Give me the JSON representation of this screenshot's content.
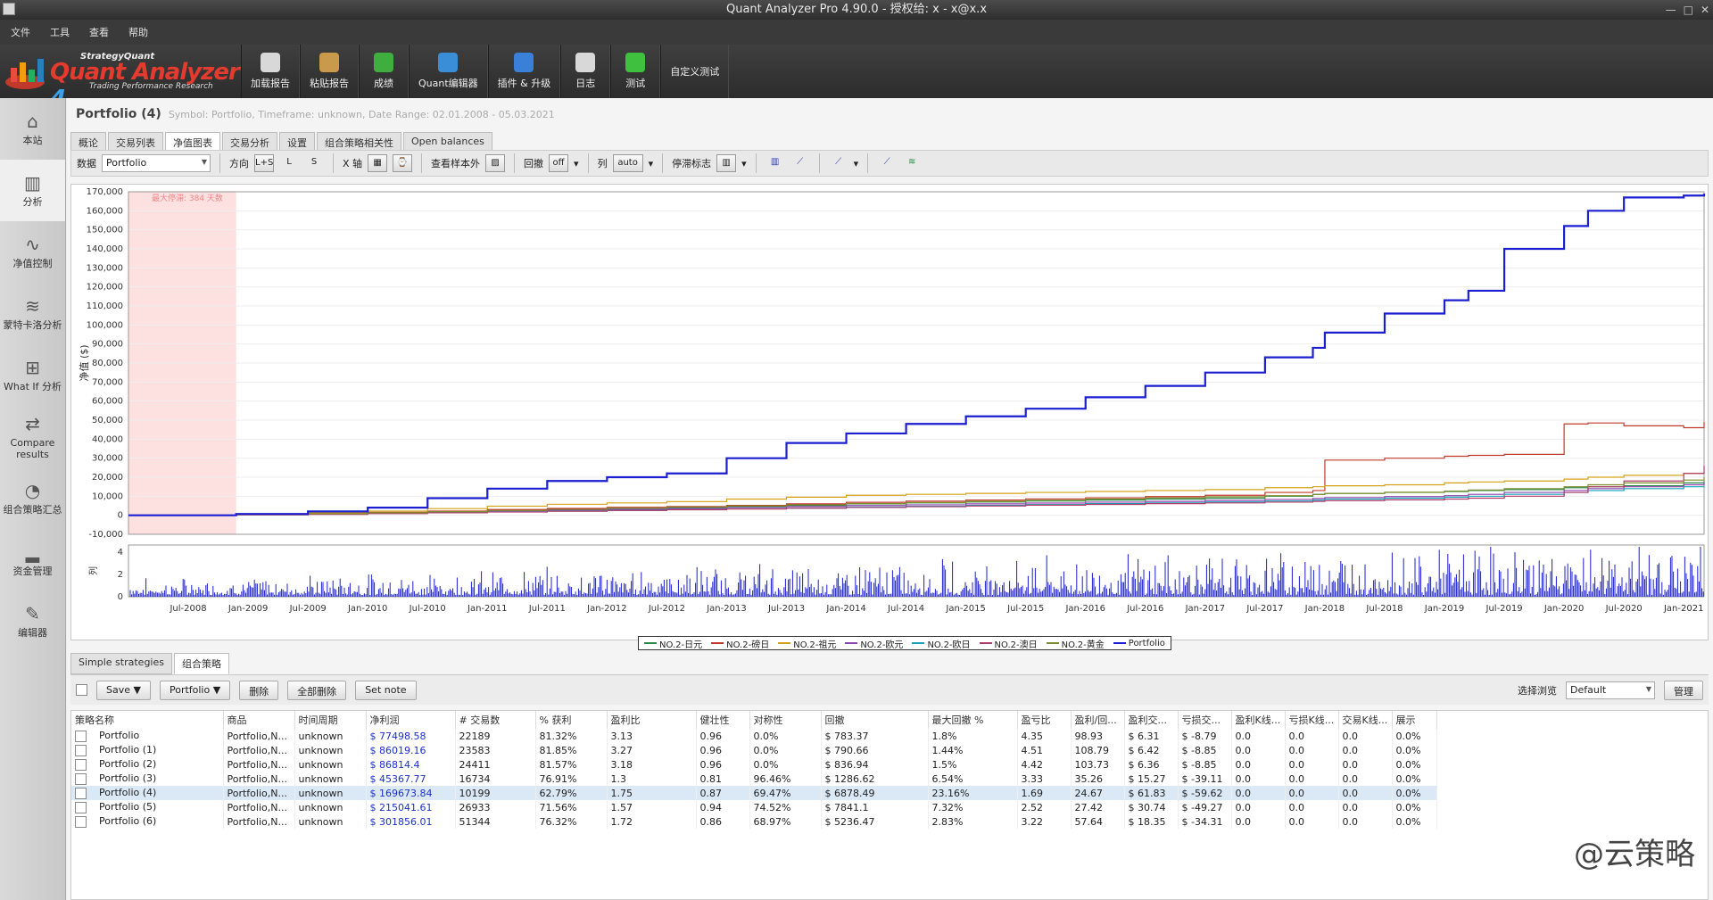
{
  "window": {
    "title": "Quant Analyzer Pro 4.90.0 - 授权给: x - x@x.x"
  },
  "menu": [
    "文件",
    "工具",
    "查看",
    "帮助"
  ],
  "logo": {
    "brand": "StrategyQuant",
    "name_a": "Quant Analyzer",
    "name_b": " 4",
    "tagline": "Trading Performance     Research"
  },
  "toolbar": [
    {
      "label": "加载报告",
      "icon": "load-report-icon",
      "color": "#d8d8d8"
    },
    {
      "label": "粘贴报告",
      "icon": "paste-report-icon",
      "color": "#c99a4b"
    },
    {
      "label": "成绩",
      "icon": "money-icon",
      "color": "#3fae3f"
    },
    {
      "label": "Quant编辑器",
      "icon": "quant-editor-icon",
      "color": "#3a8ed8"
    },
    {
      "label": "插件 & 升级",
      "icon": "plugin-icon",
      "color": "#3a7fd8"
    },
    {
      "label": "日志",
      "icon": "log-icon",
      "color": "#d8d8d8"
    },
    {
      "label": "测试",
      "icon": "check-icon",
      "color": "#3fc03f"
    },
    {
      "label": "自定义测试",
      "icon": "",
      "color": ""
    }
  ],
  "sidebar": [
    {
      "label": "本站",
      "icon": "home-icon",
      "glyph": "⌂"
    },
    {
      "label": "分析",
      "icon": "analysis-icon",
      "glyph": "▥"
    },
    {
      "label": "净值控制",
      "icon": "equity-control-icon",
      "glyph": "∿"
    },
    {
      "label": "蒙特卡洛分析",
      "icon": "monte-carlo-icon",
      "glyph": "≋"
    },
    {
      "label": "What If 分析",
      "icon": "what-if-icon",
      "glyph": "⊞"
    },
    {
      "label": "Compare results",
      "icon": "compare-icon",
      "glyph": "⇄"
    },
    {
      "label": "组合策略汇总",
      "icon": "pie-icon",
      "glyph": "◔"
    },
    {
      "label": "资金管理",
      "icon": "money-management-icon",
      "glyph": "▂"
    },
    {
      "label": "编辑器",
      "icon": "pencil-icon",
      "glyph": "✎"
    }
  ],
  "portfolio": {
    "title": "Portfolio (4)",
    "meta": "Symbol: Portfolio, Timeframe: unknown, Date Range: 02.01.2008 - 05.03.2021"
  },
  "tabs_top": [
    "概论",
    "交易列表",
    "净值图表",
    "交易分析",
    "设置",
    "组合策略相关性",
    "Open balances"
  ],
  "controls": {
    "data_label": "数据",
    "data_value": "Portfolio",
    "dir_label": "方向",
    "dir_opts": [
      "L+S",
      "L",
      "S"
    ],
    "x_label": "X 轴",
    "oos_label": "查看样本外",
    "dd_label": "回撤",
    "col_label": "列",
    "stag_label": "停滞标志"
  },
  "chart_data": {
    "type": "line",
    "ylabel": "净值 ($)",
    "ylim": [
      -10000,
      170000
    ],
    "yticks": [
      "170,000",
      "160,000",
      "150,000",
      "140,000",
      "130,000",
      "120,000",
      "110,000",
      "100,000",
      "90,000",
      "80,000",
      "70,000",
      "60,000",
      "50,000",
      "40,000",
      "30,000",
      "20,000",
      "10,000",
      "0",
      "-10,000"
    ],
    "x_labels": [
      "Jul-2008",
      "Jan-2009",
      "Jul-2009",
      "Jan-2010",
      "Jul-2010",
      "Jan-2011",
      "Jul-2011",
      "Jan-2012",
      "Jul-2012",
      "Jan-2013",
      "Jul-2013",
      "Jan-2014",
      "Jul-2014",
      "Jan-2015",
      "Jul-2015",
      "Jan-2016",
      "Jul-2016",
      "Jan-2017",
      "Jul-2017",
      "Jan-2018",
      "Jul-2018",
      "Jan-2019",
      "Jul-2019",
      "Jan-2020",
      "Jul-2020",
      "Jan-2021"
    ],
    "stagnation_label": "最大停滞: 384 天数",
    "x_dates": [
      2008.0,
      2008.9,
      2009.5,
      2010.0,
      2010.5,
      2011.0,
      2011.5,
      2012.0,
      2012.5,
      2013.0,
      2013.5,
      2014.0,
      2014.5,
      2015.0,
      2015.5,
      2016.0,
      2016.5,
      2017.0,
      2017.5,
      2017.9,
      2018.0,
      2018.5,
      2019.0,
      2019.2,
      2019.5,
      2020.0,
      2020.2,
      2020.5,
      2021.0,
      2021.17
    ],
    "series": [
      {
        "name": "NO.2-日元",
        "color": "#2a8a4a",
        "values": [
          0,
          500,
          1000,
          1500,
          2000,
          2500,
          3000,
          3500,
          4000,
          4500,
          5000,
          6000,
          6500,
          7000,
          7500,
          8000,
          8500,
          9000,
          10000,
          11000,
          11500,
          12000,
          12500,
          13000,
          13500,
          14500,
          15000,
          15500,
          17000,
          18000
        ]
      },
      {
        "name": "NO.2-磅日",
        "color": "#c0392b",
        "values": [
          0,
          600,
          900,
          1500,
          2200,
          3000,
          3600,
          4200,
          4600,
          5200,
          6000,
          6800,
          7400,
          8000,
          8600,
          9200,
          9800,
          10500,
          12000,
          13000,
          29000,
          30000,
          31000,
          31500,
          32000,
          48000,
          48500,
          47000,
          46000,
          49000
        ]
      },
      {
        "name": "NO.2-祖元",
        "color": "#d4a017",
        "values": [
          0,
          800,
          1300,
          2200,
          3500,
          4800,
          5800,
          6500,
          7200,
          8500,
          9500,
          10500,
          11000,
          11500,
          12000,
          12500,
          13000,
          13500,
          14500,
          15000,
          15500,
          16000,
          17000,
          17500,
          18000,
          19000,
          20000,
          21000,
          22000,
          22500
        ]
      },
      {
        "name": "NO.2-欧元",
        "color": "#8e44ad",
        "values": [
          0,
          400,
          700,
          1200,
          1800,
          2300,
          2700,
          3200,
          3600,
          4100,
          4600,
          5100,
          5500,
          6000,
          6400,
          6900,
          7300,
          7800,
          8300,
          8800,
          9300,
          9800,
          10300,
          11000,
          12000,
          13000,
          14000,
          15000,
          16000,
          17000
        ]
      },
      {
        "name": "NO.2-欧日",
        "color": "#17a2b8",
        "values": [
          0,
          300,
          600,
          1000,
          1400,
          1800,
          2200,
          2600,
          3000,
          3400,
          3800,
          4300,
          4700,
          5200,
          5600,
          6100,
          6500,
          7000,
          7500,
          8000,
          8500,
          9000,
          9500,
          10000,
          11000,
          12000,
          13000,
          14000,
          15000,
          15500
        ]
      },
      {
        "name": "NO.2-澳日",
        "color": "#b03a6a",
        "values": [
          0,
          200,
          500,
          900,
          1300,
          1700,
          2100,
          2500,
          2900,
          3300,
          3700,
          4100,
          4500,
          4900,
          5300,
          5700,
          6100,
          6500,
          6900,
          7300,
          7700,
          8100,
          8500,
          9000,
          10000,
          12000,
          15000,
          18000,
          22000,
          26000
        ]
      },
      {
        "name": "NO.2-黄金",
        "color": "#7f8c2d",
        "values": [
          0,
          400,
          800,
          1300,
          1900,
          2500,
          3100,
          3700,
          4300,
          4900,
          5500,
          6100,
          6700,
          7300,
          7900,
          8500,
          9100,
          9700,
          10300,
          10900,
          11500,
          12100,
          12700,
          13300,
          14000,
          15000,
          16000,
          17000,
          18500,
          20000
        ]
      },
      {
        "name": "Portfolio",
        "color": "#1b1fd0",
        "values": [
          0,
          700,
          2000,
          4000,
          9000,
          14000,
          18000,
          20000,
          22000,
          30000,
          38000,
          43000,
          48000,
          52000,
          56000,
          62000,
          68000,
          75000,
          83000,
          88000,
          96000,
          106000,
          113000,
          118000,
          140000,
          152000,
          160000,
          167000,
          168000,
          169000
        ]
      }
    ],
    "sub_ylabel": "列",
    "sub_yticks": [
      "4",
      "2",
      "0"
    ]
  },
  "bottom_tabs": [
    "Simple strategies",
    "组合策略"
  ],
  "bottom_buttons": [
    "Save ▼",
    "Portfolio ▼",
    "删除",
    "全部删除",
    "Set note"
  ],
  "view_label": "选择浏览",
  "view_value": "Default",
  "manage_label": "管理",
  "table": {
    "headers": [
      "策略名称",
      "商品",
      "时间周期",
      "净利润",
      "# 交易数",
      "% 获利",
      "盈利比",
      "健壮性",
      "对称性",
      "回撤",
      "最大回撤 %",
      "盈亏比",
      "盈利/回...",
      "盈利交...",
      "亏损交...",
      "盈利K线...",
      "亏损K线...",
      "交易K线...",
      "展示"
    ],
    "rows": [
      [
        "Portfolio",
        "Portfolio,N...",
        "unknown",
        "$ 77498.58",
        "22189",
        "81.32%",
        "3.13",
        "0.96",
        "0.0%",
        "$ 783.37",
        "1.8%",
        "4.35",
        "98.93",
        "$ 6.31",
        "$ -8.79",
        "0.0",
        "0.0",
        "0.0",
        "0.0%"
      ],
      [
        "Portfolio (1)",
        "Portfolio,N...",
        "unknown",
        "$ 86019.16",
        "23583",
        "81.85%",
        "3.27",
        "0.96",
        "0.0%",
        "$ 790.66",
        "1.44%",
        "4.51",
        "108.79",
        "$ 6.42",
        "$ -8.85",
        "0.0",
        "0.0",
        "0.0",
        "0.0%"
      ],
      [
        "Portfolio (2)",
        "Portfolio,N...",
        "unknown",
        "$ 86814.4",
        "24411",
        "81.57%",
        "3.18",
        "0.96",
        "0.0%",
        "$ 836.94",
        "1.5%",
        "4.42",
        "103.73",
        "$ 6.36",
        "$ -8.85",
        "0.0",
        "0.0",
        "0.0",
        "0.0%"
      ],
      [
        "Portfolio (3)",
        "Portfolio,N...",
        "unknown",
        "$ 45367.77",
        "16734",
        "76.91%",
        "1.3",
        "0.81",
        "96.46%",
        "$ 1286.62",
        "6.54%",
        "3.33",
        "35.26",
        "$ 15.27",
        "$ -39.11",
        "0.0",
        "0.0",
        "0.0",
        "0.0%"
      ],
      [
        "Portfolio (4)",
        "Portfolio,N...",
        "unknown",
        "$ 169673.84",
        "10199",
        "62.79%",
        "1.75",
        "0.87",
        "69.47%",
        "$ 6878.49",
        "23.16%",
        "1.69",
        "24.67",
        "$ 61.83",
        "$ -59.62",
        "0.0",
        "0.0",
        "0.0",
        "0.0%"
      ],
      [
        "Portfolio (5)",
        "Portfolio,N...",
        "unknown",
        "$ 215041.61",
        "26933",
        "71.56%",
        "1.57",
        "0.94",
        "74.52%",
        "$ 7841.1",
        "7.32%",
        "2.52",
        "27.42",
        "$ 30.74",
        "$ -49.27",
        "0.0",
        "0.0",
        "0.0",
        "0.0%"
      ],
      [
        "Portfolio (6)",
        "Portfolio,N...",
        "unknown",
        "$ 301856.01",
        "51344",
        "76.32%",
        "1.72",
        "0.86",
        "68.97%",
        "$ 5236.47",
        "2.83%",
        "3.22",
        "57.64",
        "$ 18.35",
        "$ -34.31",
        "0.0",
        "0.0",
        "0.0",
        "0.0%"
      ]
    ],
    "selected_row": 4
  },
  "watermark": "@云策略"
}
